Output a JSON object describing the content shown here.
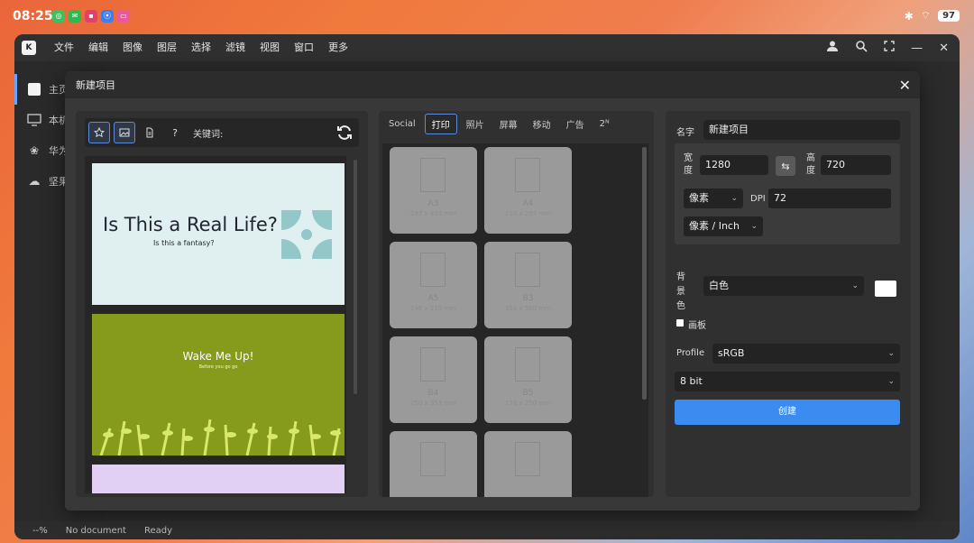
{
  "status_bar": {
    "time": "08:25",
    "battery": "97"
  },
  "menubar": {
    "logo": "K",
    "items": [
      "文件",
      "编辑",
      "图像",
      "图层",
      "选择",
      "滤镜",
      "视图",
      "窗口",
      "更多"
    ]
  },
  "sidebar": {
    "items": [
      {
        "label": "主页"
      },
      {
        "label": "本机"
      },
      {
        "label": "华为"
      },
      {
        "label": "坚果"
      }
    ]
  },
  "app_status": {
    "zoom": "--%",
    "doc": "No document",
    "state": "Ready"
  },
  "dialog": {
    "title": "新建项目",
    "templates": {
      "keyword_label": "关键词:",
      "help": "?",
      "cards": [
        {
          "title": "Is This a Real Life?",
          "subtitle": "Is this a fantasy?"
        },
        {
          "title": "Wake Me Up!",
          "subtitle": "Before you go go"
        }
      ]
    },
    "sizes": {
      "tabs": [
        "Social",
        "打印",
        "照片",
        "屏幕",
        "移动",
        "广告",
        "2ᴺ"
      ],
      "active_tab": "打印",
      "cards": [
        {
          "name": "A3",
          "dim": "297 x 420 mm"
        },
        {
          "name": "A4",
          "dim": "210 x 297 mm"
        },
        {
          "name": "A5",
          "dim": "148 x 210 mm"
        },
        {
          "name": "B3",
          "dim": "353 x 500 mm"
        },
        {
          "name": "B4",
          "dim": "250 x 353 mm"
        },
        {
          "name": "B5",
          "dim": "176 x 250 mm"
        },
        {
          "name": "",
          "dim": ""
        },
        {
          "name": "",
          "dim": ""
        }
      ]
    },
    "props": {
      "name_label": "名字",
      "name_value": "新建项目",
      "width_label": "宽度",
      "width_value": "1280",
      "height_label": "高度",
      "height_value": "720",
      "unit": "像素",
      "dpi_label": "DPI",
      "dpi_value": "72",
      "res_unit": "像素 / Inch",
      "bg_label": "背景色",
      "bg_value": "白色",
      "artboard_label": "画板",
      "profile_label": "Profile",
      "profile_value": "sRGB",
      "bit_value": "8 bit",
      "create_label": "创建"
    }
  },
  "colors": {
    "accent": "#3a8cf0",
    "selected_border": "#5b8bd9",
    "card1_bg": "#e0eff0",
    "card2_bg": "#869a1c",
    "card3_bg": "#e2d0f4"
  }
}
